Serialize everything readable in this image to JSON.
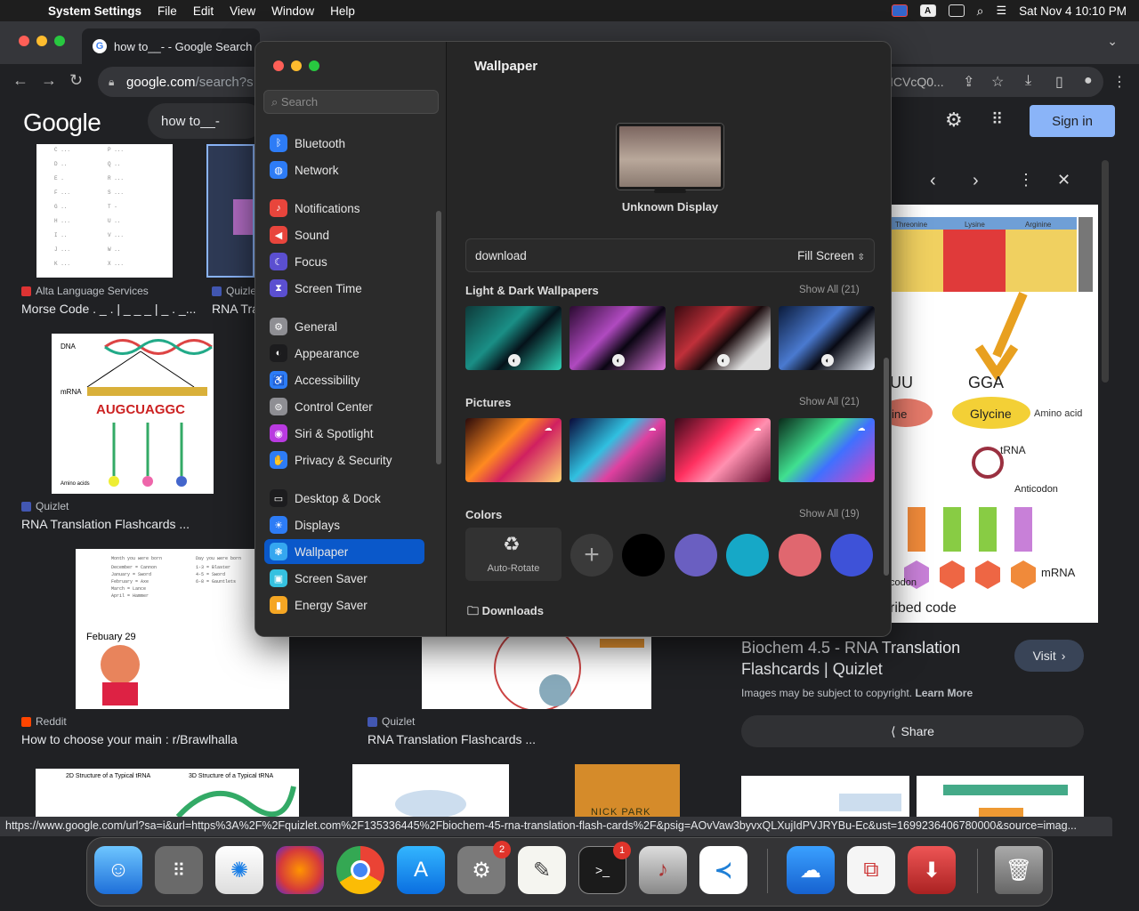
{
  "menubar": {
    "app": "System Settings",
    "items": [
      "File",
      "Edit",
      "View",
      "Window",
      "Help"
    ],
    "datetime": "Sat Nov 4  10:10 PM"
  },
  "browser": {
    "tab_title": "how to__- - Google Search",
    "url_host": "google.com",
    "url_rest": "/search?s",
    "url_tail": "ICVcQ0...",
    "google_logo": "Google",
    "query": "how to__-",
    "sign_in": "Sign in",
    "results": [
      {
        "source": "Alta Language Services",
        "title": "Morse Code . _ . | _ _ _ | _ . _..."
      },
      {
        "source": "Quizle",
        "title": "RNA Tra"
      },
      {
        "source": "Quizlet",
        "title": "RNA Translation Flashcards ..."
      },
      {
        "source": "Reddit",
        "title": "How to choose your main : r/Brawlhalla"
      },
      {
        "source": "Quizlet",
        "title": "RNA Translation Flashcards ..."
      }
    ],
    "thumb_texts": {
      "dna": "DNA",
      "mrna": "mRNA",
      "codons": "AUGCUAGGC",
      "amino": "Amino acids",
      "feb": "Febuary 29",
      "nick": "NICK PARK",
      "struct2d": "2D Structure of a Typical tRNA",
      "struct3d": "3D Structure of a Typical tRNA"
    },
    "panel": {
      "title": "Biochem 4.5 - RNA Translation Flashcards | Quizlet",
      "visit": "Visit",
      "copyright": "Images may be subject to copyright.",
      "learn_more": "Learn More",
      "share": "Share",
      "img_labels": {
        "gga": "GGA",
        "glycine": "Glycine",
        "amino": "Amino acid",
        "trna": "tRNA",
        "anticodon": "Anticodon",
        "mrna": "mRNA",
        "codon": "codon",
        "cribed": "ribed code",
        "uu": "UU",
        "ne": "ine"
      },
      "table_headers": [
        "Threonine",
        "Lysine",
        "Arginine"
      ]
    },
    "status_url": "https://www.google.com/url?sa=i&url=https%3A%2F%2Fquizlet.com%2F135336445%2Fbiochem-45-rna-translation-flash-cards%2F&psig=AOvVaw3byvxQLXujIdPVJRYBu-Ec&ust=1699236406780000&source=imag..."
  },
  "settings": {
    "search_placeholder": "Search",
    "sidebar": [
      {
        "label": "Bluetooth",
        "icon": "bluetooth-icon",
        "color": "#2d7cf6"
      },
      {
        "label": "Network",
        "icon": "globe-icon",
        "color": "#2d7cf6"
      },
      {
        "label": "Notifications",
        "icon": "bell-icon",
        "color": "#e8453c"
      },
      {
        "label": "Sound",
        "icon": "speaker-icon",
        "color": "#e8453c"
      },
      {
        "label": "Focus",
        "icon": "moon-icon",
        "color": "#5b4fd0"
      },
      {
        "label": "Screen Time",
        "icon": "hourglass-icon",
        "color": "#5b4fd0"
      },
      {
        "label": "General",
        "icon": "gear-icon",
        "color": "#8e8e93"
      },
      {
        "label": "Appearance",
        "icon": "appearance-icon",
        "color": "#1c1c1e"
      },
      {
        "label": "Accessibility",
        "icon": "accessibility-icon",
        "color": "#2d7cf6"
      },
      {
        "label": "Control Center",
        "icon": "toggle-icon",
        "color": "#8e8e93"
      },
      {
        "label": "Siri & Spotlight",
        "icon": "siri-icon",
        "color": "#b93ae0"
      },
      {
        "label": "Privacy & Security",
        "icon": "hand-icon",
        "color": "#2d7cf6"
      },
      {
        "label": "Desktop & Dock",
        "icon": "dock-icon",
        "color": "#1c1c1e"
      },
      {
        "label": "Displays",
        "icon": "sun-icon",
        "color": "#2d7cf6"
      },
      {
        "label": "Wallpaper",
        "icon": "wallpaper-icon",
        "color": "#35a7f0"
      },
      {
        "label": "Screen Saver",
        "icon": "screensaver-icon",
        "color": "#35c1e0"
      },
      {
        "label": "Energy Saver",
        "icon": "battery-icon",
        "color": "#f5a623"
      }
    ],
    "title": "Wallpaper",
    "display_name": "Unknown Display",
    "current": "download",
    "fill_mode": "Fill Screen",
    "sections": {
      "light_dark": {
        "title": "Light & Dark Wallpapers",
        "show_all": "Show All (21)"
      },
      "pictures": {
        "title": "Pictures",
        "show_all": "Show All (21)"
      },
      "colors": {
        "title": "Colors",
        "show_all": "Show All (19)"
      }
    },
    "auto_rotate": "Auto-Rotate",
    "colors": [
      "#000000",
      "#6a5fc1",
      "#16a8c7",
      "#e0676f",
      "#3e52d8"
    ],
    "downloads": "Downloads"
  },
  "dock": {
    "badges": {
      "settings": "2",
      "terminal": "1"
    },
    "terminal_prompt": ">_"
  }
}
